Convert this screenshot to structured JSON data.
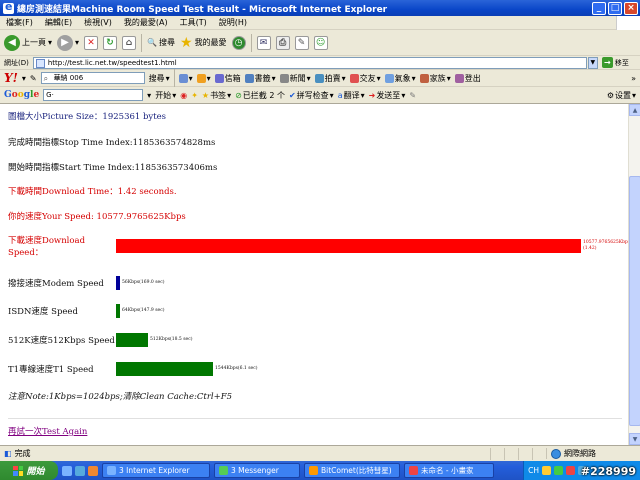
{
  "window": {
    "title": "總房測速結果Machine Room Speed Test Result - Microsoft Internet Explorer"
  },
  "menu": {
    "items": [
      "檔案(F)",
      "編輯(E)",
      "檢視(V)",
      "我的最愛(A)",
      "工具(T)",
      "說明(H)"
    ]
  },
  "toolbar": {
    "back": "上一頁",
    "search": "搜尋",
    "favorites": "我的最愛"
  },
  "address": {
    "label": "網址(D)",
    "url": "http://test.lic.net.tw/speedtest1.html",
    "go": "移至"
  },
  "yahoo": {
    "search_value": "華納 006",
    "search_btn": "搜尋",
    "items": [
      "信箱",
      "書籤",
      "新聞",
      "拍賣",
      "交友",
      "氣象",
      "家族",
      "登出"
    ]
  },
  "google": {
    "logo": "Google",
    "search_placeholder": "G·",
    "items": [
      "开始",
      "书签",
      "已拦截 2 个",
      "拼写检查",
      "翻译",
      "发送至"
    ],
    "settings": "设置"
  },
  "content": {
    "picture_size": "圖檔大小Picture Size：1925361 bytes",
    "stop_time": "完成時間指標Stop Time Index:1185363574828ms",
    "start_time": "開始時間指標Start Time Index:1185363573406ms",
    "download_time": "下載時間Download Time：1.42 seconds.",
    "your_speed": "你的速度Your Speed: 10577.9765625Kbps",
    "bars": [
      {
        "label": "下載速度Download Speed：",
        "value_text": "10577.9765625Kbps",
        "sub_text": "(1.42)",
        "kbps": 10577.98,
        "color": "#ff0000",
        "label_color": "#d50000"
      },
      {
        "label": "撥接速度Modem Speed",
        "value_text": "56Kbps(169.0 sec)",
        "sub_text": "",
        "kbps": 56,
        "color": "#000099",
        "label_color": "#111111"
      },
      {
        "label": "ISDN速度 Speed",
        "value_text": "64Kbps(147.9 sec)",
        "sub_text": "",
        "kbps": 64,
        "color": "#007700",
        "label_color": "#111111"
      },
      {
        "label": "512K速度512Kbps Speed",
        "value_text": "512Kbps(18.5 sec)",
        "sub_text": "",
        "kbps": 512,
        "color": "#007700",
        "label_color": "#111111"
      },
      {
        "label": "T1專線速度T1 Speed",
        "value_text": "1544Kbps(6.1 sec)",
        "sub_text": "",
        "kbps": 1544,
        "color": "#007700",
        "label_color": "#111111"
      }
    ],
    "note": "注意Note:1Kbps=1024bps;清除Clean Cache:Ctrl+F5",
    "again": "再試一次Test Again"
  },
  "status": {
    "text": "完成",
    "zone": "網際網路"
  },
  "taskbar": {
    "start": "開始",
    "tasks": [
      "3 Internet Explorer",
      "3 Messenger",
      "BitComet(比特彗星)",
      "未命名 - 小畫家"
    ],
    "tray_lang": "CH"
  },
  "watermark": "#228999"
}
